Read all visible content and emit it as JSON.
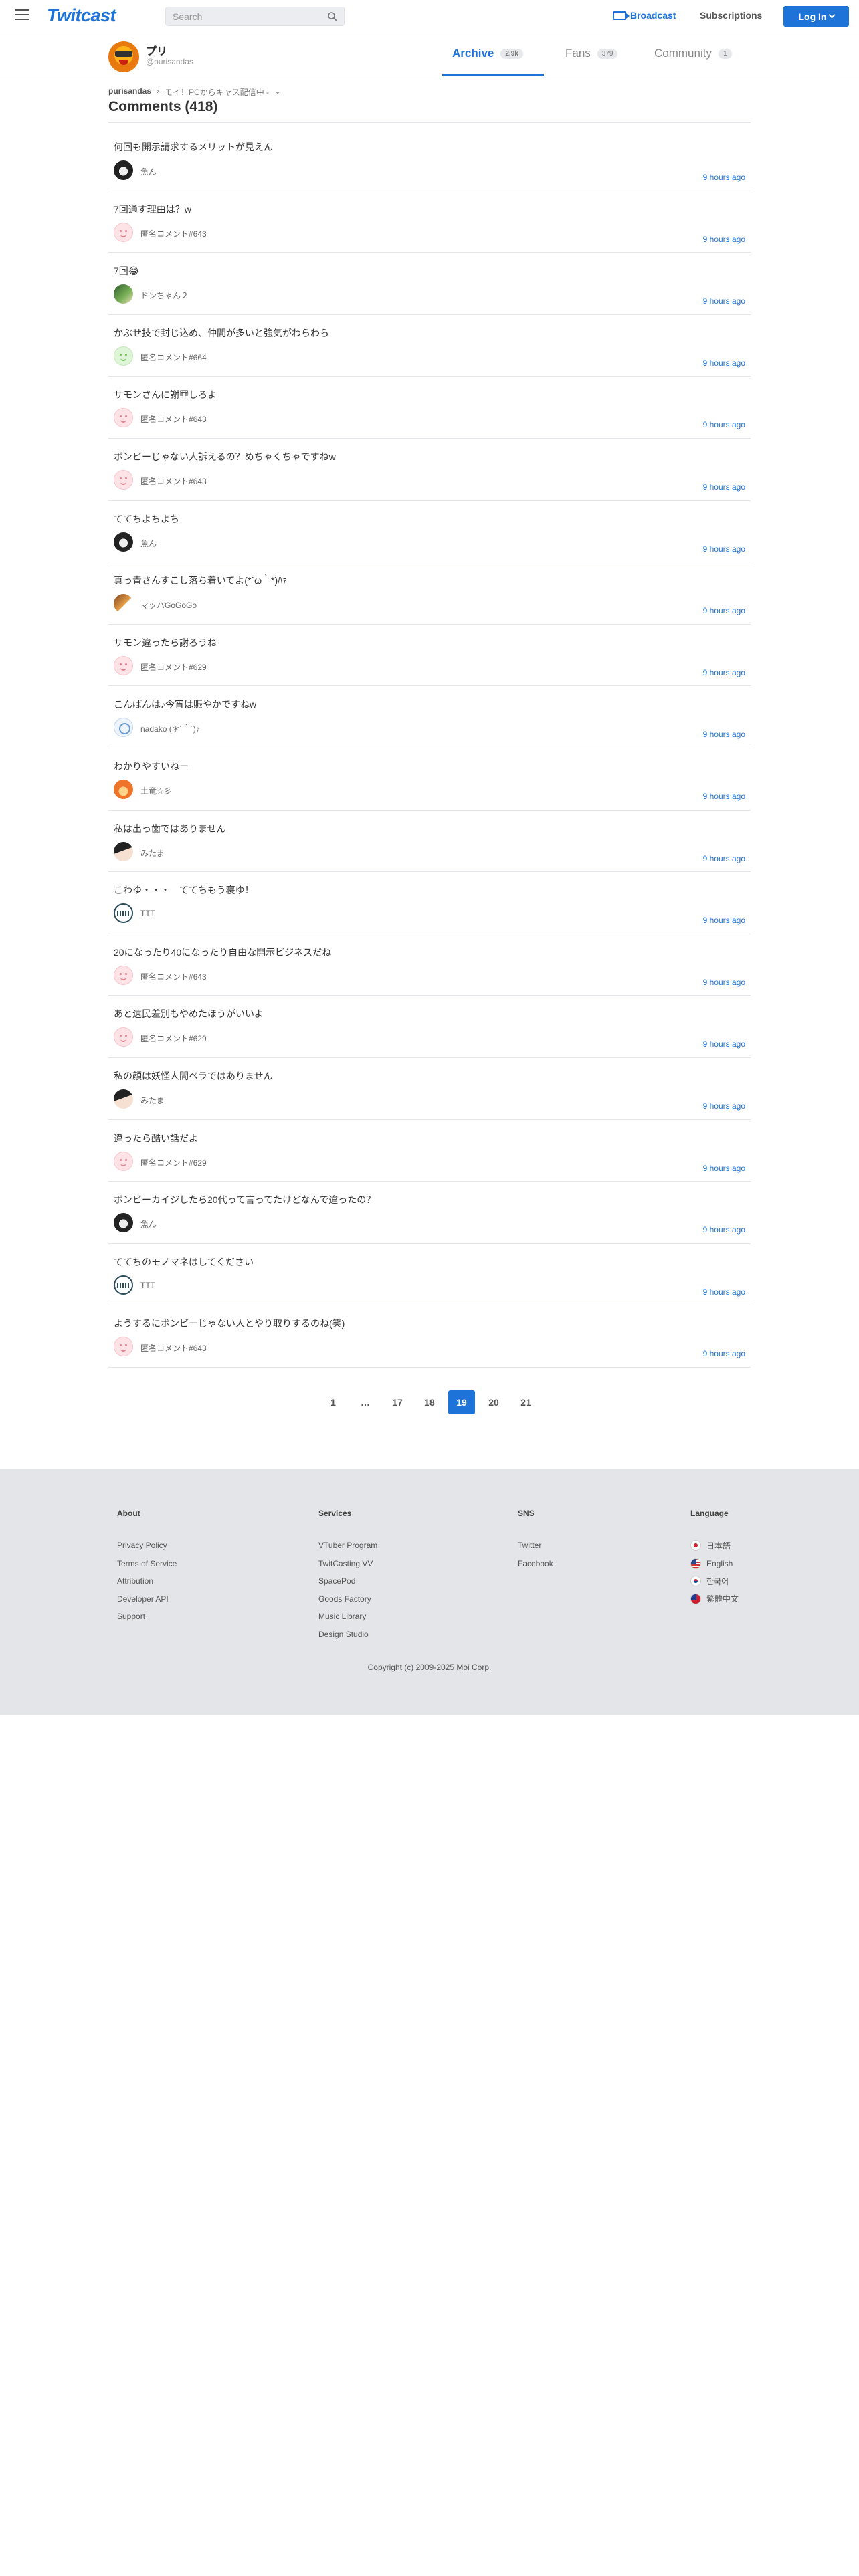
{
  "header": {
    "logo": "Twitcast",
    "search_placeholder": "Search",
    "broadcast": "Broadcast",
    "subscriptions": "Subscriptions",
    "login": "Log In"
  },
  "profile": {
    "name": "プリ",
    "handle": "@purisandas",
    "tabs": [
      {
        "label": "Archive",
        "count": "2.9k"
      },
      {
        "label": "Fans",
        "count": "379"
      },
      {
        "label": "Community",
        "count": "1"
      }
    ]
  },
  "breadcrumb": {
    "user": "purisandas",
    "separator": "›",
    "movie": "モイ！PCからキャス配信中 -",
    "dropdown_glyph": "⌄"
  },
  "page_title": "Comments (418)",
  "comments": [
    {
      "text": "何回も開示請求するメリットが見えん",
      "user": "魚ん",
      "time": "9 hours ago",
      "avatar": "dark"
    },
    {
      "text": "7回通す理由は？w",
      "user": "匿名コメント#643",
      "time": "9 hours ago",
      "avatar": "anon"
    },
    {
      "text": "7回😂",
      "user": "ドンちゃん２",
      "time": "9 hours ago",
      "avatar": "green"
    },
    {
      "text": "かぶせ技で封じ込め、仲間が多いと強気がわらわら",
      "user": "匿名コメント#664",
      "time": "9 hours ago",
      "avatar": "anon-green"
    },
    {
      "text": "サモンさんに謝罪しろよ",
      "user": "匿名コメント#643",
      "time": "9 hours ago",
      "avatar": "anon"
    },
    {
      "text": "ボンビーじゃない人訴えるの？めちゃくちゃですねw",
      "user": "匿名コメント#643",
      "time": "9 hours ago",
      "avatar": "anon"
    },
    {
      "text": "ててちよちよち",
      "user": "魚ん",
      "time": "9 hours ago",
      "avatar": "dark"
    },
    {
      "text": "真っ青さんすこし落ち着いてよ(*´ω｀*)ﾊｧ",
      "user": "マッハGoGoGo",
      "time": "9 hours ago",
      "avatar": "brown"
    },
    {
      "text": "サモン違ったら謝ろうね",
      "user": "匿名コメント#629",
      "time": "9 hours ago",
      "avatar": "anon"
    },
    {
      "text": "こんばんは♪今宵は賑やかですねw",
      "user": "nadako (＊´｀´)♪",
      "time": "9 hours ago",
      "avatar": "light"
    },
    {
      "text": "わかりやすいねー",
      "user": "土竜☆彡",
      "time": "9 hours ago",
      "avatar": "orange"
    },
    {
      "text": "私は出っ歯ではありません",
      "user": "みたま",
      "time": "9 hours ago",
      "avatar": "girl"
    },
    {
      "text": "こわゆ・・・　ててちもう寝ゆ！",
      "user": "TTT",
      "time": "9 hours ago",
      "avatar": "ttt"
    },
    {
      "text": "20になったり40になったり自由な開示ビジネスだね",
      "user": "匿名コメント#643",
      "time": "9 hours ago",
      "avatar": "anon"
    },
    {
      "text": "あと遠民差別もやめたほうがいいよ",
      "user": "匿名コメント#629",
      "time": "9 hours ago",
      "avatar": "anon"
    },
    {
      "text": "私の顔は妖怪人間ベラではありません",
      "user": "みたま",
      "time": "9 hours ago",
      "avatar": "girl"
    },
    {
      "text": "違ったら酷い話だよ",
      "user": "匿名コメント#629",
      "time": "9 hours ago",
      "avatar": "anon"
    },
    {
      "text": "ボンビーカイジしたら20代って言ってたけどなんで違ったの？",
      "user": "魚ん",
      "time": "9 hours ago",
      "avatar": "dark"
    },
    {
      "text": "ててちのモノマネはしてください",
      "user": "TTT",
      "time": "9 hours ago",
      "avatar": "ttt"
    },
    {
      "text": "ようするにボンビーじゃない人とやり取りするのね(笑)",
      "user": "匿名コメント#643",
      "time": "9 hours ago",
      "avatar": "anon"
    }
  ],
  "pagination": [
    "1",
    "…",
    "17",
    "18",
    "19",
    "20",
    "21"
  ],
  "pagination_current": "19",
  "footer": {
    "about": {
      "heading": "About",
      "links": [
        "Privacy Policy",
        "Terms of Service",
        "Attribution",
        "Developer API",
        "Support"
      ]
    },
    "services": {
      "heading": "Services",
      "links": [
        "VTuber Program",
        "TwitCasting VV",
        "SpacePod",
        "Goods Factory",
        "Music Library",
        "Design Studio"
      ]
    },
    "sns": {
      "heading": "SNS",
      "links": [
        "Twitter",
        "Facebook"
      ]
    },
    "language": {
      "heading": "Language",
      "links": [
        {
          "label": "日本語",
          "flag": "jp"
        },
        {
          "label": "English",
          "flag": "us"
        },
        {
          "label": "한국어",
          "flag": "kr"
        },
        {
          "label": "繁體中文",
          "flag": "tw"
        }
      ]
    },
    "copyright": "Copyright (c) 2009-2025 Moi Corp."
  },
  "colors": {
    "accent": "#1e73d9",
    "footer_bg": "#e3e5e8",
    "divider": "#e4e6ea"
  },
  "icons": {
    "menu": "hamburger-icon",
    "search": "search-icon",
    "broadcast": "broadcast-icon",
    "login_caret": "chevron-down-icon"
  }
}
